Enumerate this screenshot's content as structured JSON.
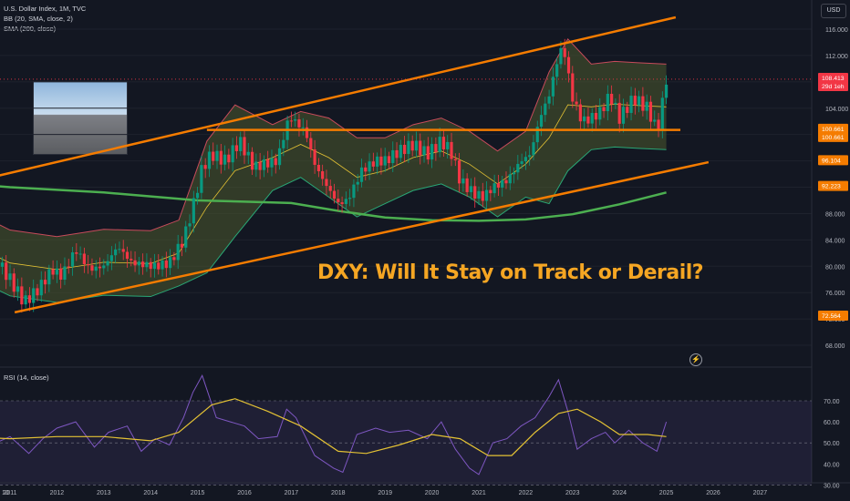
{
  "chart_data": {
    "type": "candlestick",
    "title": "U.S. Dollar Index, 1M, TVC",
    "indicators": [
      "BB (20, SMA, close, 2)",
      "SMA (200, close)"
    ],
    "currency_button": "USD",
    "headline": "DXY: Will It Stay on Track or Derail?",
    "price_axis": {
      "ticks": [
        "116.000",
        "112.000",
        "108.000",
        "104.000",
        "100.000",
        "96.000",
        "92.000",
        "88.000",
        "84.000",
        "80.000",
        "76.000",
        "72.000",
        "68.000"
      ],
      "range": [
        66,
        119
      ]
    },
    "x_axis": {
      "ticks": [
        "10",
        "2011",
        "2012",
        "2013",
        "2014",
        "2015",
        "2016",
        "2017",
        "2018",
        "2019",
        "2020",
        "2021",
        "2022",
        "2023",
        "2024",
        "2025",
        "2026",
        "2027"
      ]
    },
    "price_labels": [
      {
        "value": "108.413",
        "sub": "29d 1eh",
        "color": "#f23645"
      },
      {
        "value": "100.661",
        "sub": "100.661",
        "color": "#f57c00"
      },
      {
        "value": "96.104",
        "sub": "",
        "color": "#f57c00"
      },
      {
        "value": "92.223",
        "sub": "",
        "color": "#f57c00"
      },
      {
        "value": "72.564",
        "sub": "",
        "color": "#f57c00"
      }
    ],
    "price_path": [
      [
        2010.0,
        79.5
      ],
      [
        2010.4,
        86.5
      ],
      [
        2010.8,
        80.0
      ],
      [
        2011.0,
        78.0
      ],
      [
        2011.3,
        74.5
      ],
      [
        2011.6,
        76.5
      ],
      [
        2011.9,
        79.5
      ],
      [
        2012.1,
        78.5
      ],
      [
        2012.4,
        82.5
      ],
      [
        2012.7,
        79.5
      ],
      [
        2013.0,
        80.0
      ],
      [
        2013.3,
        83.0
      ],
      [
        2013.6,
        80.5
      ],
      [
        2013.9,
        80.2
      ],
      [
        2014.1,
        80.0
      ],
      [
        2014.4,
        80.5
      ],
      [
        2014.7,
        84.0
      ],
      [
        2014.9,
        89.0
      ],
      [
        2015.1,
        95.0
      ],
      [
        2015.3,
        97.0
      ],
      [
        2015.6,
        96.0
      ],
      [
        2015.9,
        99.0
      ],
      [
        2016.2,
        95.0
      ],
      [
        2016.4,
        95.5
      ],
      [
        2016.7,
        96.0
      ],
      [
        2016.9,
        101.5
      ],
      [
        2017.0,
        102.5
      ],
      [
        2017.3,
        100.5
      ],
      [
        2017.5,
        95.5
      ],
      [
        2017.7,
        92.8
      ],
      [
        2018.0,
        89.5
      ],
      [
        2018.2,
        90.0
      ],
      [
        2018.5,
        94.5
      ],
      [
        2018.8,
        96.0
      ],
      [
        2019.0,
        96.0
      ],
      [
        2019.3,
        97.5
      ],
      [
        2019.6,
        98.5
      ],
      [
        2019.9,
        97.0
      ],
      [
        2020.2,
        99.0
      ],
      [
        2020.4,
        97.5
      ],
      [
        2020.6,
        93.0
      ],
      [
        2020.9,
        91.0
      ],
      [
        2021.1,
        90.5
      ],
      [
        2021.3,
        92.0
      ],
      [
        2021.6,
        93.0
      ],
      [
        2021.9,
        96.0
      ],
      [
        2022.1,
        97.0
      ],
      [
        2022.3,
        102.5
      ],
      [
        2022.5,
        106.0
      ],
      [
        2022.7,
        112.0
      ],
      [
        2022.8,
        113.5
      ],
      [
        2023.0,
        105.5
      ],
      [
        2023.2,
        102.0
      ],
      [
        2023.4,
        102.5
      ],
      [
        2023.6,
        103.5
      ],
      [
        2023.8,
        106.0
      ],
      [
        2024.0,
        102.5
      ],
      [
        2024.3,
        105.5
      ],
      [
        2024.6,
        104.0
      ],
      [
        2024.8,
        100.5
      ],
      [
        2024.9,
        104.0
      ],
      [
        2025.0,
        108.4
      ]
    ],
    "rsi": {
      "label": "RSI (14, close)",
      "ticks": [
        "70.00",
        "60.00",
        "50.00",
        "40.00",
        "30.00"
      ],
      "upper": 70,
      "lower": 30,
      "path": [
        [
          2010,
          55
        ],
        [
          2010.3,
          58
        ],
        [
          2010.6,
          49
        ],
        [
          2011,
          53
        ],
        [
          2011.4,
          45
        ],
        [
          2011.7,
          52
        ],
        [
          2012,
          57
        ],
        [
          2012.4,
          60
        ],
        [
          2012.8,
          48
        ],
        [
          2013.1,
          55
        ],
        [
          2013.5,
          58
        ],
        [
          2013.8,
          46
        ],
        [
          2014.1,
          52
        ],
        [
          2014.4,
          49
        ],
        [
          2014.7,
          62
        ],
        [
          2014.9,
          74
        ],
        [
          2015.1,
          82
        ],
        [
          2015.4,
          62
        ],
        [
          2015.7,
          60
        ],
        [
          2016.0,
          58
        ],
        [
          2016.3,
          52
        ],
        [
          2016.7,
          53
        ],
        [
          2016.9,
          66
        ],
        [
          2017.1,
          62
        ],
        [
          2017.5,
          44
        ],
        [
          2017.9,
          38
        ],
        [
          2018.1,
          36
        ],
        [
          2018.4,
          54
        ],
        [
          2018.8,
          57
        ],
        [
          2019.1,
          55
        ],
        [
          2019.5,
          56
        ],
        [
          2019.9,
          52
        ],
        [
          2020.2,
          60
        ],
        [
          2020.5,
          47
        ],
        [
          2020.8,
          38
        ],
        [
          2021.0,
          35
        ],
        [
          2021.3,
          50
        ],
        [
          2021.6,
          52
        ],
        [
          2021.9,
          58
        ],
        [
          2022.2,
          62
        ],
        [
          2022.5,
          72
        ],
        [
          2022.7,
          80
        ],
        [
          2022.9,
          65
        ],
        [
          2023.1,
          47
        ],
        [
          2023.4,
          52
        ],
        [
          2023.7,
          55
        ],
        [
          2023.9,
          50
        ],
        [
          2024.2,
          56
        ],
        [
          2024.5,
          50
        ],
        [
          2024.8,
          46
        ],
        [
          2025.0,
          60
        ]
      ],
      "ma_path": [
        [
          2010,
          53
        ],
        [
          2011,
          52
        ],
        [
          2012,
          53
        ],
        [
          2013,
          53
        ],
        [
          2014,
          51
        ],
        [
          2014.6,
          55
        ],
        [
          2015.3,
          68
        ],
        [
          2015.8,
          71
        ],
        [
          2016.5,
          65
        ],
        [
          2017.2,
          58
        ],
        [
          2018,
          46
        ],
        [
          2018.6,
          45
        ],
        [
          2019.3,
          49
        ],
        [
          2020,
          54
        ],
        [
          2020.6,
          52
        ],
        [
          2021.2,
          44
        ],
        [
          2021.7,
          44
        ],
        [
          2022.2,
          55
        ],
        [
          2022.7,
          64
        ],
        [
          2023.1,
          66
        ],
        [
          2023.6,
          60
        ],
        [
          2024.0,
          54
        ],
        [
          2024.6,
          54
        ],
        [
          2025.0,
          53
        ]
      ]
    },
    "sma200_path": [
      [
        2010,
        92.6
      ],
      [
        2011,
        92.0
      ],
      [
        2012,
        91.6
      ],
      [
        2013,
        91.2
      ],
      [
        2014,
        90.6
      ],
      [
        2015,
        90.0
      ],
      [
        2016,
        89.8
      ],
      [
        2017,
        89.6
      ],
      [
        2018,
        88.4
      ],
      [
        2019,
        87.4
      ],
      [
        2020,
        87.0
      ],
      [
        2021,
        86.9
      ],
      [
        2022,
        87.1
      ],
      [
        2023,
        87.9
      ],
      [
        2024,
        89.4
      ],
      [
        2025,
        91.2
      ]
    ],
    "bb_mid_path": [
      [
        2010,
        84
      ],
      [
        2011,
        80.5
      ],
      [
        2012,
        79.5
      ],
      [
        2013,
        80.6
      ],
      [
        2014,
        80.4
      ],
      [
        2014.6,
        82
      ],
      [
        2015.2,
        89
      ],
      [
        2015.8,
        94.5
      ],
      [
        2016.6,
        96.5
      ],
      [
        2017.2,
        98.5
      ],
      [
        2017.8,
        96.5
      ],
      [
        2018.4,
        93.5
      ],
      [
        2019.0,
        94.5
      ],
      [
        2019.6,
        96.5
      ],
      [
        2020.2,
        97.5
      ],
      [
        2020.8,
        95.5
      ],
      [
        2021.4,
        92.5
      ],
      [
        2022.0,
        95.5
      ],
      [
        2022.5,
        99.5
      ],
      [
        2022.9,
        104.5
      ],
      [
        2023.4,
        104.2
      ],
      [
        2023.9,
        104.6
      ],
      [
        2024.4,
        104.4
      ],
      [
        2025.0,
        104.2
      ]
    ],
    "trend_lines": [
      {
        "name": "upper-channel",
        "points": [
          [
            2010.0,
            92.5
          ],
          [
            2025.2,
            117.8
          ]
        ],
        "color": "#f57c00"
      },
      {
        "name": "lower-channel",
        "points": [
          [
            2011.1,
            73.0
          ],
          [
            2025.9,
            95.8
          ]
        ],
        "color": "#f57c00"
      },
      {
        "name": "horizontal-support",
        "points": [
          [
            2015.2,
            100.7
          ],
          [
            2025.3,
            100.7
          ]
        ],
        "color": "#f57c00"
      }
    ],
    "colors": {
      "up": "#089981",
      "down": "#f23645",
      "bb_fill": "#4c5a2e",
      "bb_line": "#c74b5b",
      "sma200": "#4caf50",
      "rsi": "#7e57c2",
      "rsi_ma": "#e4c234",
      "bg": "#131722",
      "grid": "#1e222d"
    }
  }
}
